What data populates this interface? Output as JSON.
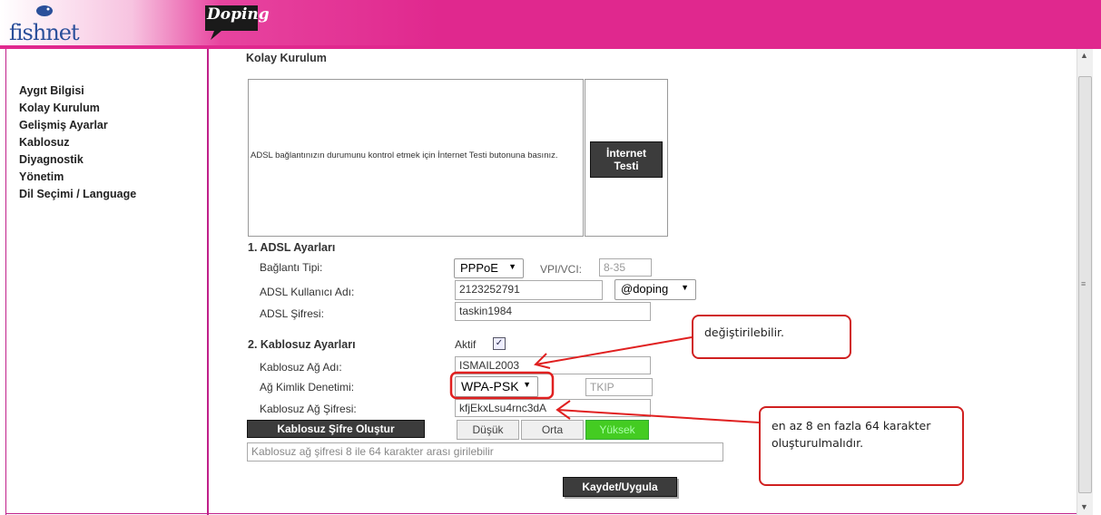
{
  "header": {
    "logo_text": "fishnet",
    "brand_badge": "Doping",
    "accent_color": "#e0288e"
  },
  "sidebar": {
    "items": [
      {
        "label": "Aygıt Bilgisi"
      },
      {
        "label": "Kolay Kurulum"
      },
      {
        "label": "Gelişmiş Ayarlar"
      },
      {
        "label": "Kablosuz"
      },
      {
        "label": "Diyagnostik"
      },
      {
        "label": "Yönetim"
      },
      {
        "label": "Dil Seçimi / Language"
      }
    ]
  },
  "main": {
    "title": "Kolay Kurulum",
    "internet_test": {
      "description": "ADSL bağlantınızın durumunu kontrol etmek için İnternet Testi butonuna basınız.",
      "button_line1": "İnternet",
      "button_line2": "Testi"
    },
    "adsl": {
      "header": "1.  ADSL Ayarları",
      "conn_type_label": "Bağlantı Tipi:",
      "conn_type_value": "PPPoE",
      "vpi_label": "VPI/VCI:",
      "vpi_placeholder": "8-35",
      "user_label": "ADSL Kullanıcı Adı:",
      "user_value": "2123252791",
      "domain_value": "@doping",
      "pass_label": "ADSL Şifresi:",
      "pass_value": "taskin1984"
    },
    "wireless": {
      "header": "2.  Kablosuz Ayarları",
      "active_label": "Aktif",
      "active_checked": true,
      "ssid_label": "Kablosuz Ağ Adı:",
      "ssid_value": "ISMAIL2003",
      "auth_label": "Ağ Kimlik Denetimi:",
      "auth_value": "WPA-PSK",
      "cipher_value": "TKIP",
      "key_label": "Kablosuz Ağ Şifresi:",
      "key_value": "kfjEkxLsu4rnc3dA",
      "generate_button": "Kablosuz Şifre Oluştur",
      "strength_low": "Düşük",
      "strength_mid": "Orta",
      "strength_high": "Yüksek",
      "hint": "Kablosuz ağ şifresi 8 ile 64 karakter arası girilebilir"
    },
    "save_button": "Kaydet/Uygula"
  },
  "annotations": {
    "callout1": "değiştirilebilir.",
    "callout2": "en az 8 en fazla 64 karakter oluşturulmalıdır."
  },
  "icons": [
    "scroll-up-icon",
    "scroll-down-icon",
    "chevron-down-icon",
    "checkbox-icon",
    "fish-logo-icon"
  ]
}
